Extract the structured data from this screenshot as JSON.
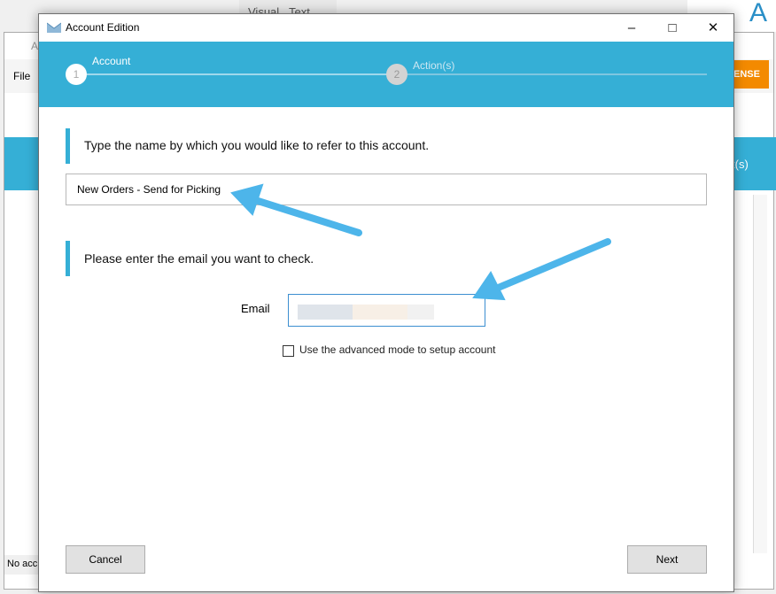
{
  "background": {
    "tabs": [
      "Visual",
      "Text"
    ],
    "app_title": "A",
    "menu_file": "File",
    "status": "No acc",
    "license_button": "ENSE",
    "band_text": "t(s)",
    "logo_text": "A"
  },
  "dialog": {
    "title": "Account Edition",
    "steps": [
      {
        "number": "1",
        "label": "Account",
        "active": true
      },
      {
        "number": "2",
        "label": "Action(s)",
        "active": false
      }
    ],
    "section1": {
      "prompt": "Type the name by which you would like to refer to this account.",
      "name_value": "New Orders - Send for Picking"
    },
    "section2": {
      "prompt": "Please enter the email you want to check.",
      "email_label": "Email",
      "email_value": ""
    },
    "advanced_mode": {
      "label": "Use the advanced mode to setup account",
      "checked": false
    },
    "buttons": {
      "cancel": "Cancel",
      "next": "Next"
    },
    "colors": {
      "accent": "#35afd6",
      "arrow": "#4db5ea",
      "license": "#f38a00"
    }
  }
}
